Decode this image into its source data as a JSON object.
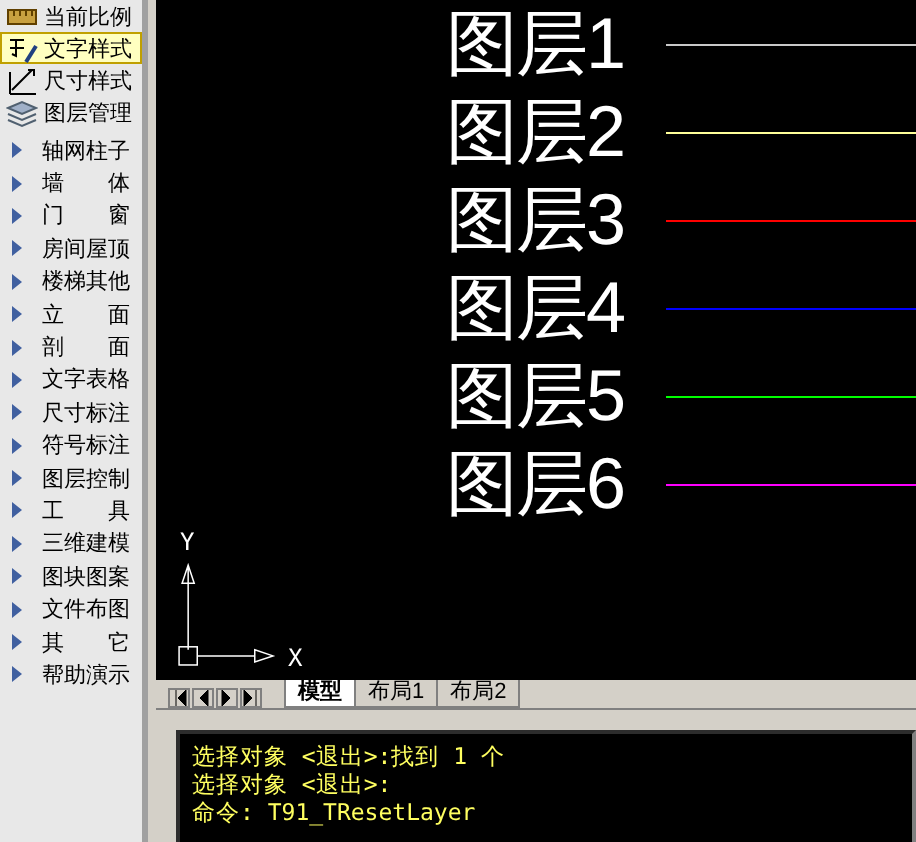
{
  "sidebar": {
    "items": [
      {
        "label": "当前比例",
        "kind": "tool",
        "selected": false
      },
      {
        "label": "文字样式",
        "kind": "tool",
        "selected": true
      },
      {
        "label": "尺寸样式",
        "kind": "tool",
        "selected": false
      },
      {
        "label": "图层管理",
        "kind": "tool",
        "selected": false
      },
      {
        "label": "轴网柱子",
        "kind": "menu",
        "selected": false
      },
      {
        "label": "墙　　体",
        "kind": "menu",
        "selected": false
      },
      {
        "label": "门　　窗",
        "kind": "menu",
        "selected": false
      },
      {
        "label": "房间屋顶",
        "kind": "menu",
        "selected": false
      },
      {
        "label": "楼梯其他",
        "kind": "menu",
        "selected": false
      },
      {
        "label": "立　　面",
        "kind": "menu",
        "selected": false
      },
      {
        "label": "剖　　面",
        "kind": "menu",
        "selected": false
      },
      {
        "label": "文字表格",
        "kind": "menu",
        "selected": false
      },
      {
        "label": "尺寸标注",
        "kind": "menu",
        "selected": false
      },
      {
        "label": "符号标注",
        "kind": "menu",
        "selected": false
      },
      {
        "label": "图层控制",
        "kind": "menu",
        "selected": false
      },
      {
        "label": "工　　具",
        "kind": "menu",
        "selected": false
      },
      {
        "label": "三维建模",
        "kind": "menu",
        "selected": false
      },
      {
        "label": "图块图案",
        "kind": "menu",
        "selected": false
      },
      {
        "label": "文件布图",
        "kind": "menu",
        "selected": false
      },
      {
        "label": "其　　它",
        "kind": "menu",
        "selected": false
      },
      {
        "label": "帮助演示",
        "kind": "menu",
        "selected": false
      }
    ]
  },
  "canvas": {
    "layers": [
      {
        "label": "图层1",
        "color": "#c8c8c8"
      },
      {
        "label": "图层2",
        "color": "#ffff99"
      },
      {
        "label": "图层3",
        "color": "#ff0000"
      },
      {
        "label": "图层4",
        "color": "#0000ff"
      },
      {
        "label": "图层5",
        "color": "#00ff00"
      },
      {
        "label": "图层6",
        "color": "#ff00ff"
      }
    ],
    "ucs": {
      "x_label": "X",
      "y_label": "Y"
    }
  },
  "tabs": [
    {
      "label": "模型",
      "selected": true
    },
    {
      "label": "布局1",
      "selected": false
    },
    {
      "label": "布局2",
      "selected": false
    }
  ],
  "command_lines": [
    "选择对象 <退出>:找到 1 个",
    "选择对象 <退出>:",
    "命令: T91_TResetLayer"
  ]
}
